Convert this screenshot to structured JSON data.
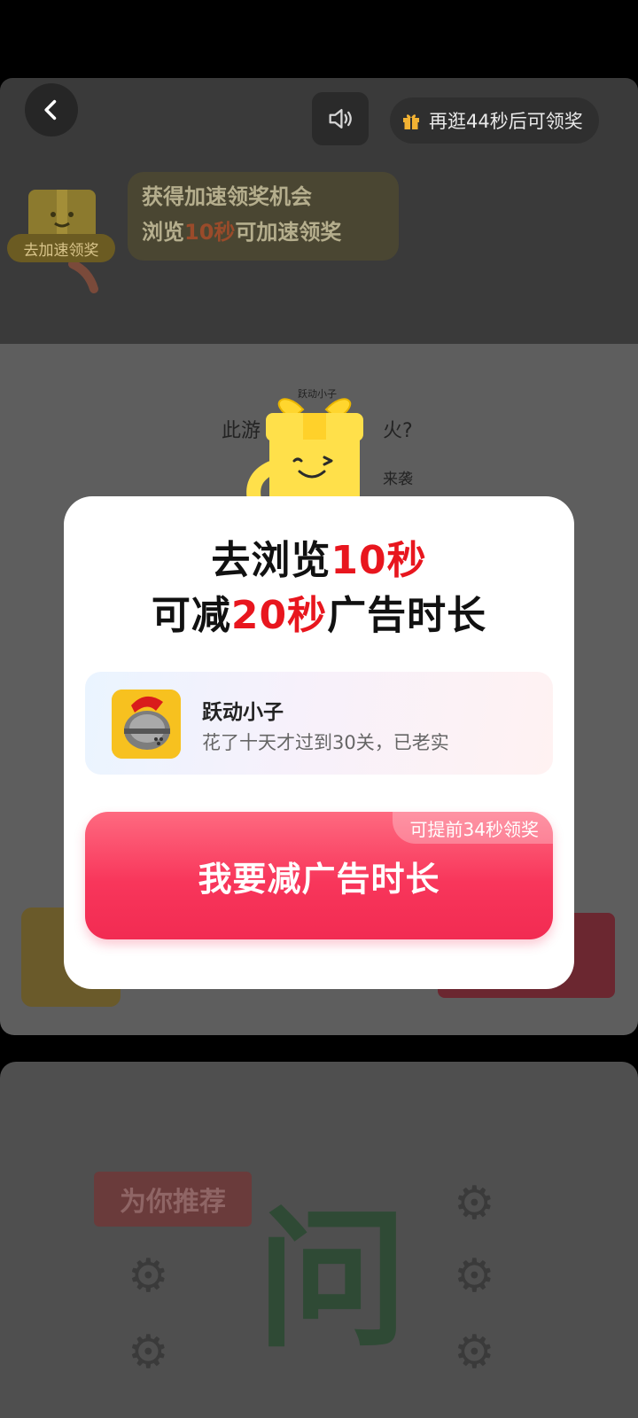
{
  "header": {
    "back_icon": "chevron-left-icon",
    "sound_icon": "speaker-icon",
    "timer_icon": "gift-icon",
    "timer_text": "再逛44秒后可领奖"
  },
  "speed_up": {
    "badge_label": "去加速领奖",
    "line1": "获得加速领奖机会",
    "line2_prefix": "浏览",
    "line2_highlight": "10秒",
    "line2_suffix": "可加速领奖"
  },
  "background": {
    "question": "此游",
    "question_tail": "火?",
    "sub_tail": "来袭",
    "mascot_caption": "跃动小子"
  },
  "recommend": {
    "tag": "为你推荐",
    "big_char": "问"
  },
  "modal": {
    "line1_prefix": "去浏览",
    "line1_highlight": "10秒",
    "line2_prefix": "可减",
    "line2_highlight": "20秒",
    "line2_suffix": "广告时长",
    "app_name": "跃动小子",
    "app_desc": "花了十天才过到30关，已老实",
    "cta_label": "我要减广告时长",
    "cta_corner": "可提前34秒领奖"
  },
  "colors": {
    "accent_red": "#e8161e",
    "cta_pink": "#f8365b",
    "mascot_yellow": "#ffe04a"
  }
}
